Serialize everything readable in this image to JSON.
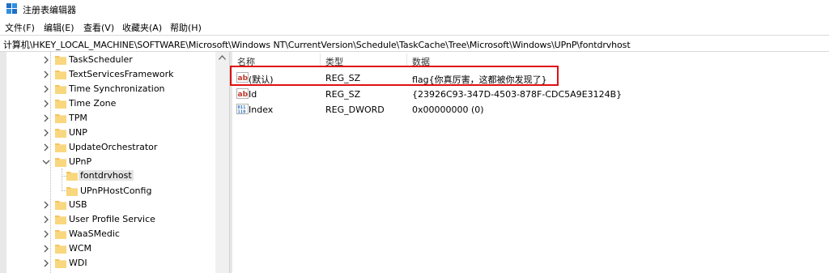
{
  "window": {
    "title": "注册表编辑器"
  },
  "menu": [
    "文件(F)",
    "编辑(E)",
    "查看(V)",
    "收藏夹(A)",
    "帮助(H)"
  ],
  "address": {
    "path": "计算机\\HKEY_LOCAL_MACHINE\\SOFTWARE\\Microsoft\\Windows NT\\CurrentVersion\\Schedule\\TaskCache\\Tree\\Microsoft\\Windows\\UPnP\\fontdrvhost"
  },
  "tree": {
    "items": [
      {
        "label": "TaskScheduler",
        "expanded": false
      },
      {
        "label": "TextServicesFramework",
        "expanded": false
      },
      {
        "label": "Time Synchronization",
        "expanded": false
      },
      {
        "label": "Time Zone",
        "expanded": false
      },
      {
        "label": "TPM",
        "expanded": false
      },
      {
        "label": "UNP",
        "expanded": false
      },
      {
        "label": "UpdateOrchestrator",
        "expanded": false
      },
      {
        "label": "UPnP",
        "expanded": true
      },
      {
        "label": "fontdrvhost",
        "selected": true
      },
      {
        "label": "UPnPHostConfig"
      },
      {
        "label": "USB",
        "expanded": false
      },
      {
        "label": "User Profile Service",
        "expanded": false
      },
      {
        "label": "WaaSMedic",
        "expanded": false
      },
      {
        "label": "WCM",
        "expanded": false
      },
      {
        "label": "WDI",
        "expanded": false
      }
    ]
  },
  "list": {
    "columns": [
      "名称",
      "类型",
      "数据"
    ],
    "rows": [
      {
        "name": "(默认)",
        "type": "REG_SZ",
        "data": "flag{你真厉害，这都被你发现了}",
        "icon": "string-value-icon"
      },
      {
        "name": "Id",
        "type": "REG_SZ",
        "data": "{23926C93-347D-4503-878F-CDC5A9E3124B}",
        "icon": "string-value-icon"
      },
      {
        "name": "Index",
        "type": "REG_DWORD",
        "data": "0x00000000 (0)",
        "icon": "binary-value-icon"
      }
    ]
  },
  "colors": {
    "folder": "#f5c45c",
    "highlight_border": "#e01010",
    "string_icon": "#c0392b",
    "binary_icon": "#2a6ebb"
  }
}
